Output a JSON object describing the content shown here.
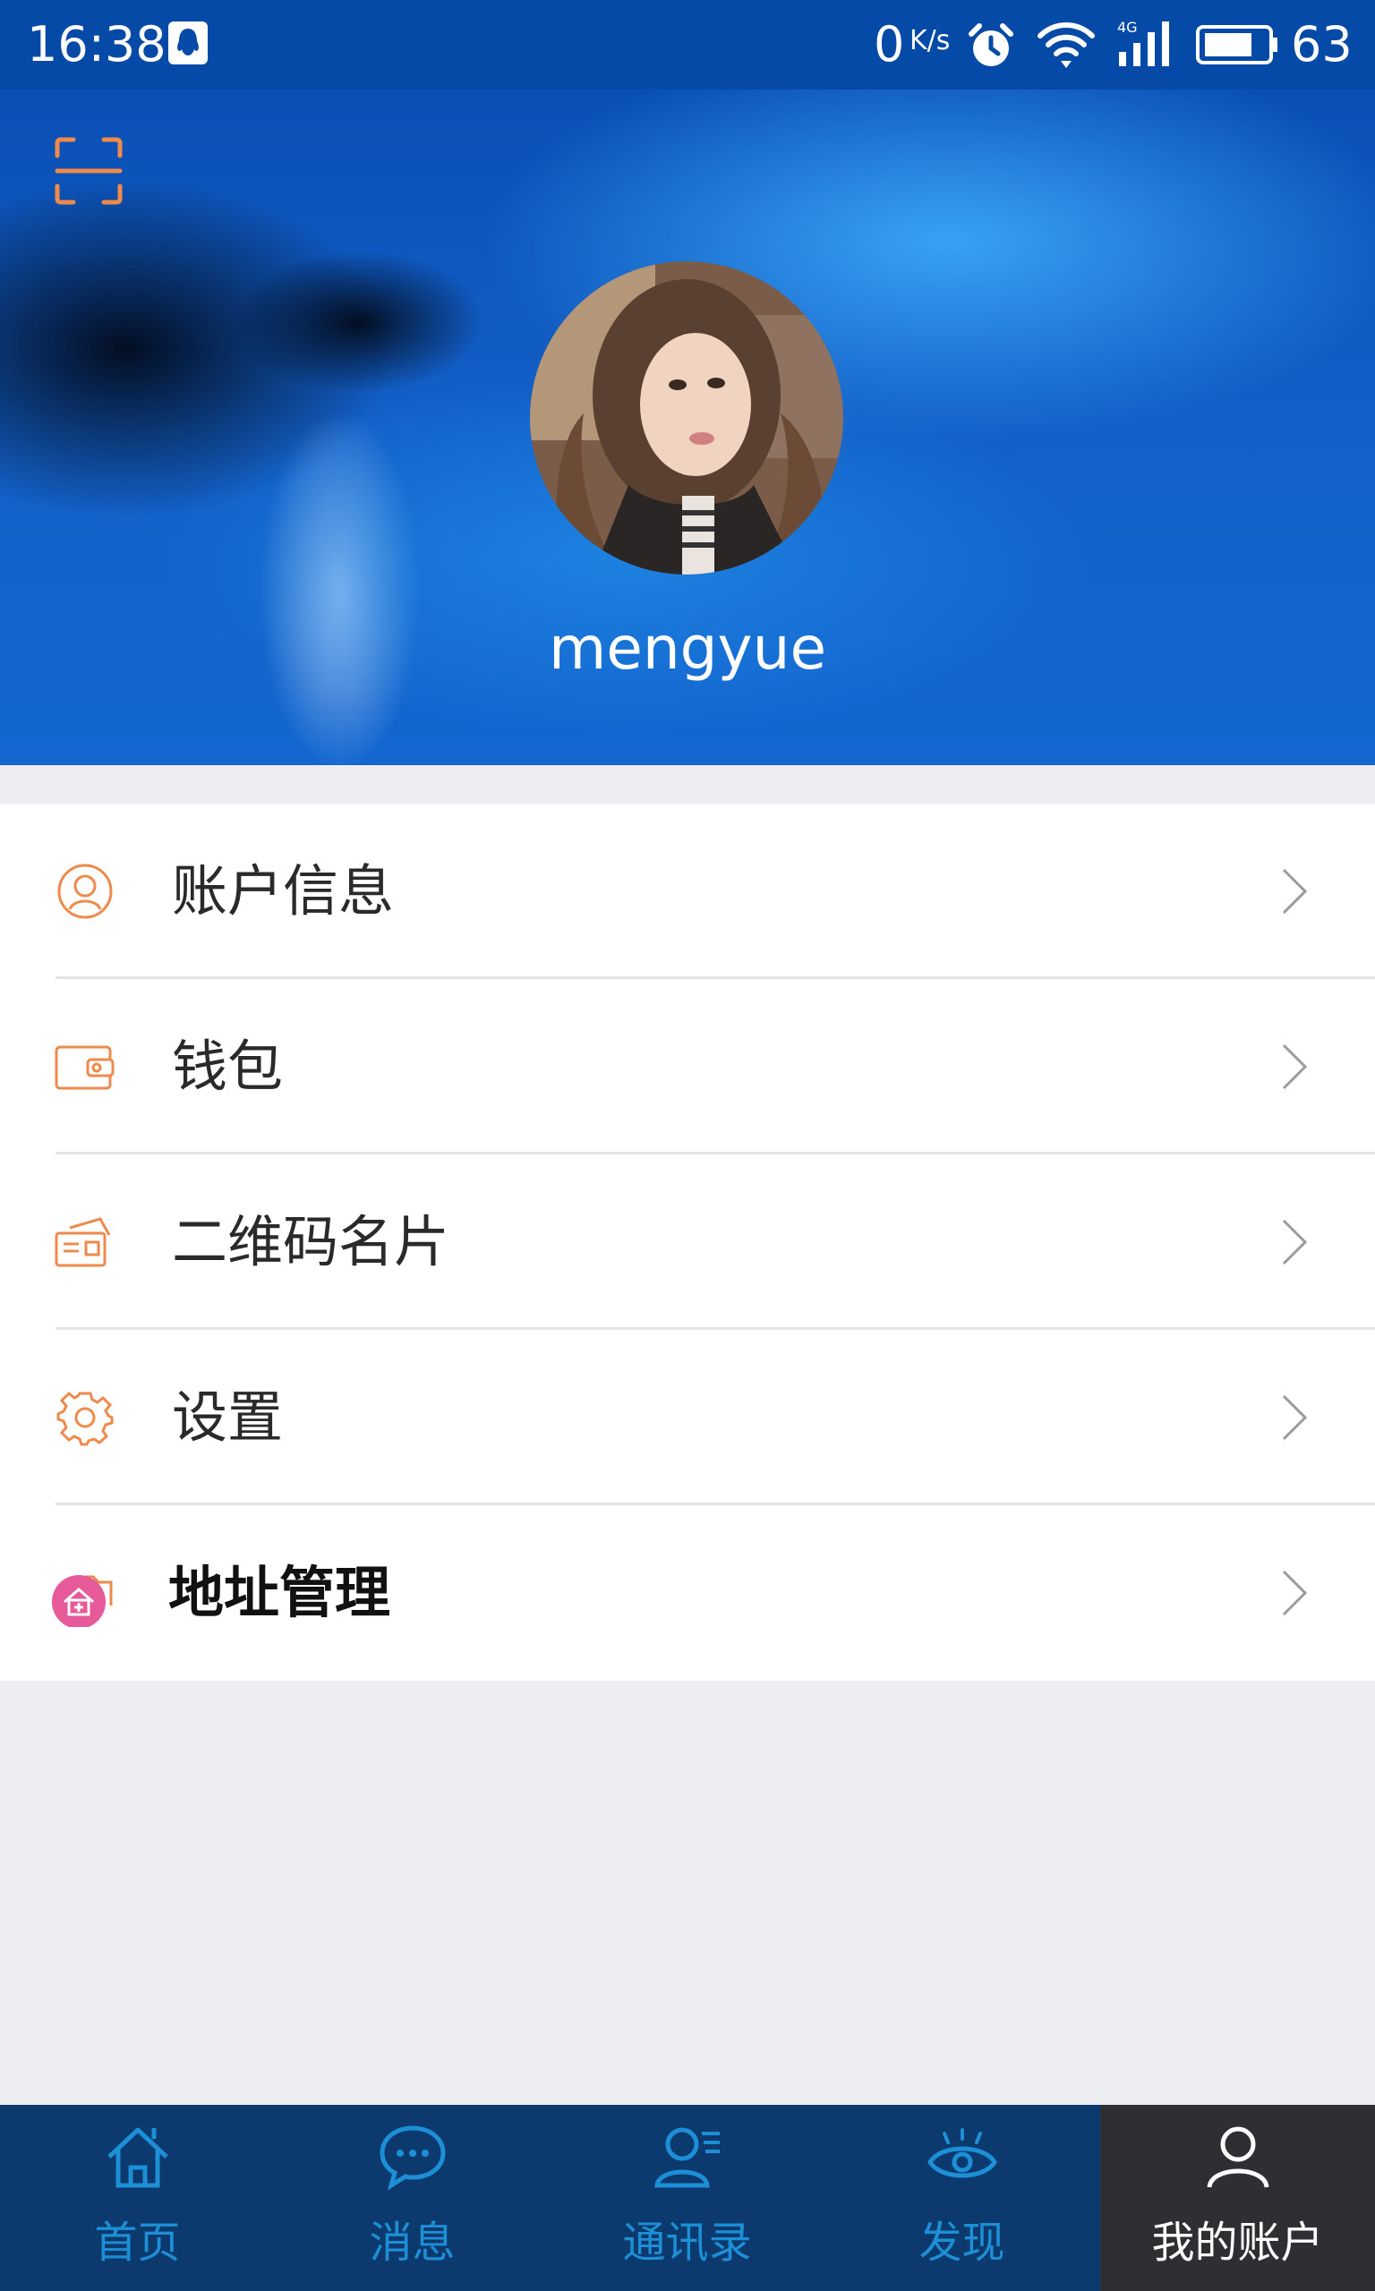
{
  "status_bar": {
    "time": "16:38",
    "net_speed": "0",
    "net_speed_unit": "K/s",
    "battery": "63",
    "icons": [
      "qq-icon",
      "alarm-icon",
      "wifi-icon",
      "4g-signal-icon",
      "battery-icon"
    ]
  },
  "profile": {
    "username": "mengyue",
    "avatar": "avatar-photo",
    "scan_icon": "scan-icon"
  },
  "menu": {
    "items": [
      {
        "label": "账户信息",
        "icon": "user-icon"
      },
      {
        "label": "钱包",
        "icon": "wallet-icon"
      },
      {
        "label": "二维码名片",
        "icon": "qr-card-icon"
      },
      {
        "label": "设置",
        "icon": "gear-icon"
      },
      {
        "label": "地址管理",
        "icon": "address-home-icon"
      }
    ]
  },
  "bottom_nav": {
    "tabs": [
      {
        "label": "首页",
        "icon": "home-icon"
      },
      {
        "label": "消息",
        "icon": "message-icon"
      },
      {
        "label": "通讯录",
        "icon": "contacts-icon"
      },
      {
        "label": "发现",
        "icon": "eye-icon"
      },
      {
        "label": "我的账户",
        "icon": "account-icon",
        "active": true
      }
    ]
  },
  "colors": {
    "status_bar": "#064aa7",
    "accent_orange": "#ee8a4c",
    "nav_background": "#0c3a6e",
    "nav_label": "#1d8fd6",
    "nav_active_background": "#2d2f33",
    "page_background": "#edeef2"
  }
}
